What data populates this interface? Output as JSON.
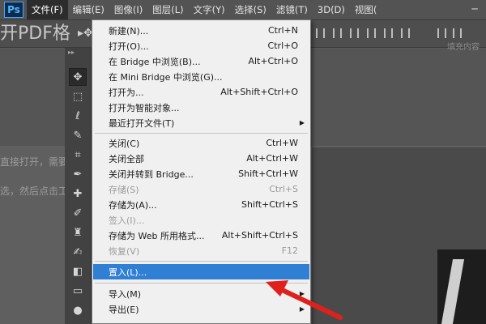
{
  "app": {
    "logo": "Ps"
  },
  "menubar": {
    "items": [
      "文件(F)",
      "编辑(E)",
      "图像(I)",
      "图层(L)",
      "文字(Y)",
      "选择(S)",
      "滤镜(T)",
      "3D(D)",
      "视图("
    ],
    "active_index": 0
  },
  "document": {
    "title_fragment": "开PDF格",
    "faded_line_1": "直接打开，需要",
    "faded_line_2": "选，然后点击工",
    "options_hint": "填充内容"
  },
  "file_menu": {
    "items": [
      {
        "label": "新建(N)...",
        "shortcut": "Ctrl+N",
        "enabled": true
      },
      {
        "label": "打开(O)...",
        "shortcut": "Ctrl+O",
        "enabled": true
      },
      {
        "label": "在 Bridge 中浏览(B)...",
        "shortcut": "Alt+Ctrl+O",
        "enabled": true
      },
      {
        "label": "在 Mini Bridge 中浏览(G)...",
        "shortcut": "",
        "enabled": true
      },
      {
        "label": "打开为...",
        "shortcut": "Alt+Shift+Ctrl+O",
        "enabled": true
      },
      {
        "label": "打开为智能对象...",
        "shortcut": "",
        "enabled": true
      },
      {
        "label": "最近打开文件(T)",
        "shortcut": "",
        "enabled": true,
        "submenu": true
      },
      {
        "label": "关闭(C)",
        "shortcut": "Ctrl+W",
        "enabled": true
      },
      {
        "label": "关闭全部",
        "shortcut": "Alt+Ctrl+W",
        "enabled": true
      },
      {
        "label": "关闭并转到 Bridge...",
        "shortcut": "Shift+Ctrl+W",
        "enabled": true
      },
      {
        "label": "存储(S)",
        "shortcut": "Ctrl+S",
        "enabled": false
      },
      {
        "label": "存储为(A)...",
        "shortcut": "Shift+Ctrl+S",
        "enabled": true
      },
      {
        "label": "签入(I)...",
        "shortcut": "",
        "enabled": false
      },
      {
        "label": "存储为 Web 所用格式...",
        "shortcut": "Alt+Shift+Ctrl+S",
        "enabled": true
      },
      {
        "label": "恢复(V)",
        "shortcut": "F12",
        "enabled": false
      },
      {
        "label": "置入(L)...",
        "shortcut": "",
        "enabled": true,
        "highlighted": true
      },
      {
        "label": "导入(M)",
        "shortcut": "",
        "enabled": true,
        "submenu": true
      },
      {
        "label": "导出(E)",
        "shortcut": "",
        "enabled": true
      }
    ]
  },
  "colors": {
    "highlight": "#2f7fd5",
    "annotation_arrow": "#e0201c",
    "menu_bg": "#f0f0f0",
    "app_bg": "#535353"
  },
  "icons": {
    "tools": [
      "move-icon",
      "marquee-icon",
      "lasso-icon",
      "quick-select-icon",
      "crop-icon",
      "eyedropper-icon",
      "healing-icon",
      "brush-icon",
      "clone-stamp-icon",
      "history-brush-icon",
      "eraser-icon",
      "gradient-icon",
      "blur-icon"
    ]
  }
}
